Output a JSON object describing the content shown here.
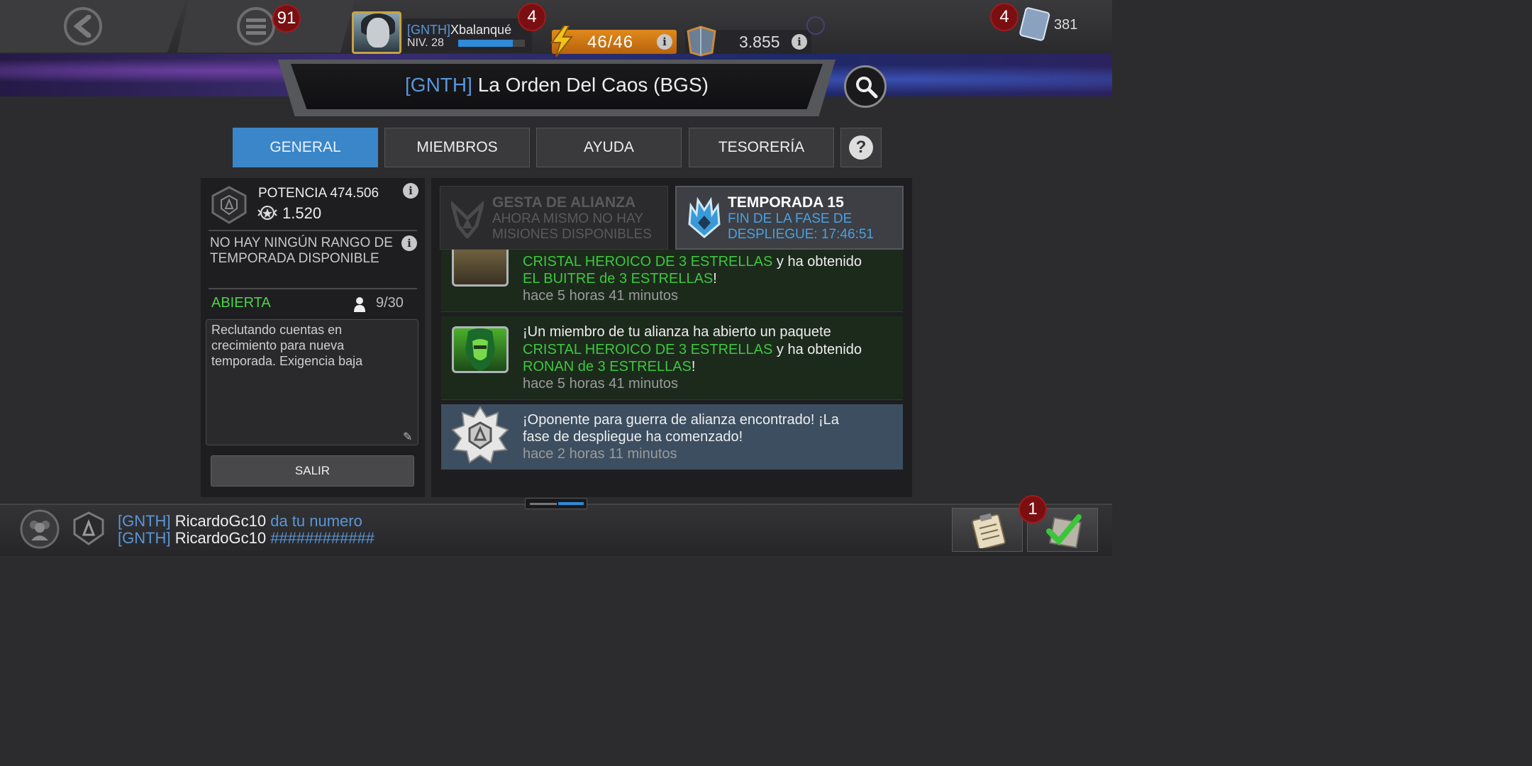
{
  "header": {
    "menu_badge": "91",
    "player": {
      "tag": "[GNTH]",
      "name": "Xbalanqué",
      "level": "NIV. 28",
      "xp_progress": 0.82,
      "badge": "4"
    },
    "energy": "46/46",
    "shards": "3.855",
    "units_badge": "4",
    "units": "381"
  },
  "alliance": {
    "tag": "[GNTH]",
    "name": "La Orden Del Caos (BGS)"
  },
  "tabs": [
    {
      "label": "GENERAL",
      "active": true
    },
    {
      "label": "MIEMBROS",
      "active": false
    },
    {
      "label": "AYUDA",
      "active": false
    },
    {
      "label": "TESORERÍA",
      "active": false
    }
  ],
  "overview": {
    "potencia": "POTENCIA 474.506",
    "trophies": "1.520",
    "rank_text": "NO HAY NINGÚN RANGO DE TEMPORADA DISPONIBLE",
    "status": "ABIERTA",
    "members": "9/30",
    "description": "Reclutando cuentas en crecimiento para nueva temporada. Exigencia baja",
    "leave_label": "SALIR"
  },
  "quest": {
    "title": "GESTA DE ALIANZA",
    "subtitle": "AHORA MISMO NO HAY MISIONES DISPONIBLES"
  },
  "season": {
    "title": "TEMPORADA 15",
    "subtitle": "FIN DE LA FASE DE DESPLIEGUE: 17:46:51"
  },
  "feed": [
    {
      "line1_hl": "CRISTAL HEROICO DE 3 ESTRELLAS",
      "line1_rest": " y ha obtenido",
      "line2_hl": "EL BUITRE de 3 ESTRELLAS",
      "line2_rest": "!",
      "time": "hace 5 horas 41 minutos"
    },
    {
      "line0": "¡Un miembro de tu alianza ha abierto un paquete",
      "line1_hl": "CRISTAL HEROICO DE 3 ESTRELLAS",
      "line1_rest": " y ha obtenido",
      "line2_hl": "RONAN de 3 ESTRELLAS",
      "line2_rest": "!",
      "time": "hace 5 horas 41 minutos"
    },
    {
      "line0": "¡Oponente para guerra de alianza encontrado! ¡La",
      "line1": "fase de despliegue ha comenzado!",
      "time": "hace 2 horas 11 minutos"
    }
  ],
  "chat": [
    {
      "tag": "[GNTH]",
      "user": "RicardoGc10",
      "msg": "da tu numero"
    },
    {
      "tag": "[GNTH]",
      "user": "RicardoGc10",
      "msg": "############"
    }
  ],
  "bottom": {
    "check_badge": "1"
  },
  "colors": {
    "accent_blue": "#3a86c8",
    "tag_blue": "#5a96d8",
    "highlight_green": "#3ec63e",
    "badge_red": "#7a0f12",
    "energy_orange": "#e08a1c"
  }
}
